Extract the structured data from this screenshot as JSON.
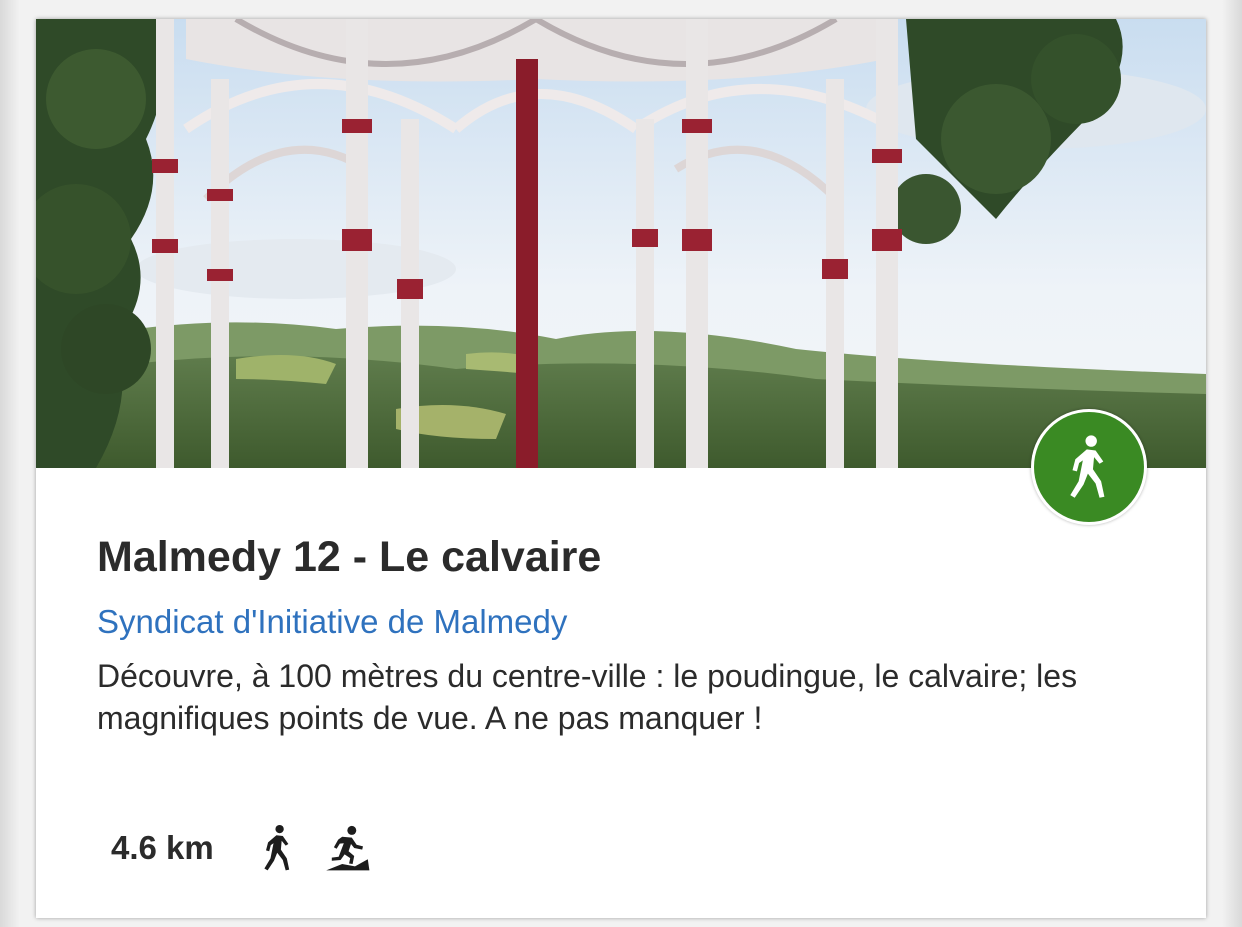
{
  "card": {
    "title": "Malmedy 12 - Le calvaire",
    "organizer": "Syndicat d'Initiative de Malmedy",
    "description": "Découvre, à 100 mètres du centre-ville : le poudingue, le calvaire; les magnifiques points de vue. A ne pas manquer !",
    "distance": "4.6 km",
    "badge_icon": "walking-icon",
    "activity_icons": [
      "walking-icon",
      "trail-running-icon"
    ],
    "image": "photo of a red and white bandstand pavilion with columns overlooking green hills"
  },
  "colors": {
    "badge_green": "#3a8a23",
    "link_blue": "#2f72be",
    "text": "#2b2b2b"
  }
}
